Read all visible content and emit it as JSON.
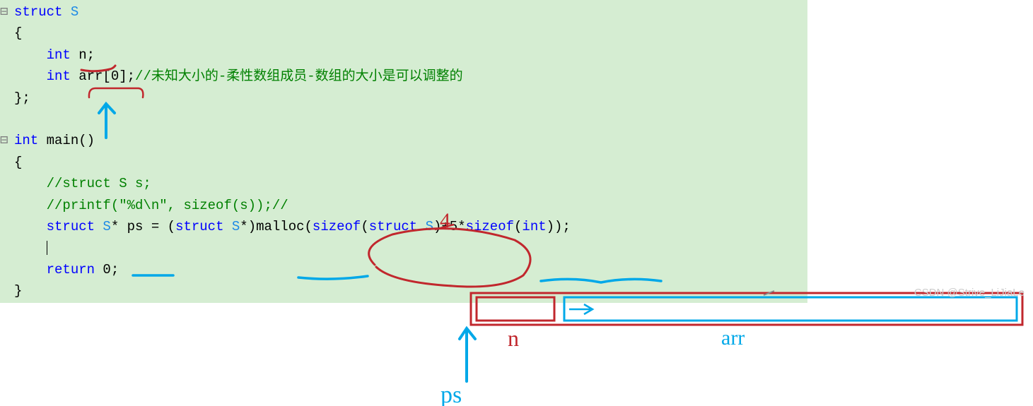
{
  "code": {
    "l1_kw": "struct",
    "l1_name": " S",
    "l2": "{",
    "l3_type": "int",
    "l3_rest": " n;",
    "l4_type": "int",
    "l4_rest": " arr[0];",
    "l4_comment": "//未知大小的-柔性数组成员-数组的大小是可以调整的",
    "l5": "};",
    "l6_type": "int",
    "l6_rest": " main()",
    "l7": "{",
    "l8_comment": "//struct S s;",
    "l9_comment": "//printf(\"%d\\n\", sizeof(s));//",
    "l10_kw1": "struct",
    "l10_name1": " S",
    "l10_p1": "* ps = (",
    "l10_kw2": "struct",
    "l10_name2": " S",
    "l10_p2": "*)malloc(",
    "l10_kw3": "sizeof",
    "l10_p3": "(",
    "l10_kw4": "struct",
    "l10_name4": " S",
    "l10_p4": ")+5*",
    "l10_kw5": "sizeof",
    "l10_p5": "(",
    "l10_type5": "int",
    "l10_p6": "));",
    "l11_kw": "return",
    "l11_rest": " 0;",
    "l12": "}"
  },
  "labels": {
    "n": "n",
    "arr": "arr",
    "ps": "ps",
    "four": "4"
  },
  "chart_data": {
    "type": "diagram",
    "struct_size_label": 4,
    "malloc_expression": "sizeof(struct S)+5*sizeof(int)",
    "pointer": "ps",
    "boxes": [
      {
        "name": "n",
        "width_units": 1
      },
      {
        "name": "arr",
        "width_units": 5
      }
    ]
  },
  "watermark": "CSDN @Strive_LiJiaLe"
}
